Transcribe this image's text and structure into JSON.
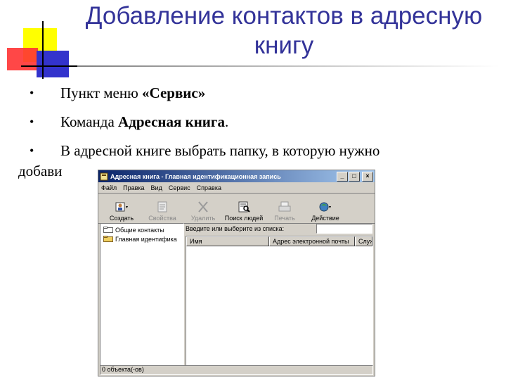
{
  "slide": {
    "title": "Добавление контактов в адресную книгу",
    "bullets": [
      {
        "prefix": "Пункт меню ",
        "bold": "«Сервис»",
        "suffix": ""
      },
      {
        "prefix": "Команда ",
        "bold": "Адресная книга",
        "suffix": "."
      },
      {
        "prefix": "В адресной книге выбрать папку, в которую нужно",
        "bold": "",
        "suffix": ""
      }
    ],
    "bullet_continuation": "добави"
  },
  "window": {
    "title": "Адресная книга - Главная идентификационная запись",
    "controls": {
      "minimize": "_",
      "maximize": "□",
      "close": "×"
    },
    "menu": [
      "Файл",
      "Правка",
      "Вид",
      "Сервис",
      "Справка"
    ],
    "toolbar": [
      {
        "label": "Создать",
        "icon": "new-contact-icon",
        "enabled": true
      },
      {
        "label": "Свойства",
        "icon": "properties-icon",
        "enabled": false
      },
      {
        "label": "Удалить",
        "icon": "delete-icon",
        "enabled": false
      },
      {
        "label": "Поиск людей",
        "icon": "find-people-icon",
        "enabled": true
      },
      {
        "label": "Печать",
        "icon": "print-icon",
        "enabled": false
      },
      {
        "label": "Действие",
        "icon": "action-icon",
        "enabled": true
      }
    ],
    "tree": [
      {
        "label": "Общие контакты",
        "icon": "folder-icon"
      },
      {
        "label": "Главная идентифика",
        "icon": "folder-icon"
      }
    ],
    "search_label": "Введите или выберите из списка:",
    "search_value": "",
    "columns": [
      "Имя",
      "Адрес электронной почты",
      "Служ"
    ],
    "status": "0 объекта(-ов)"
  }
}
